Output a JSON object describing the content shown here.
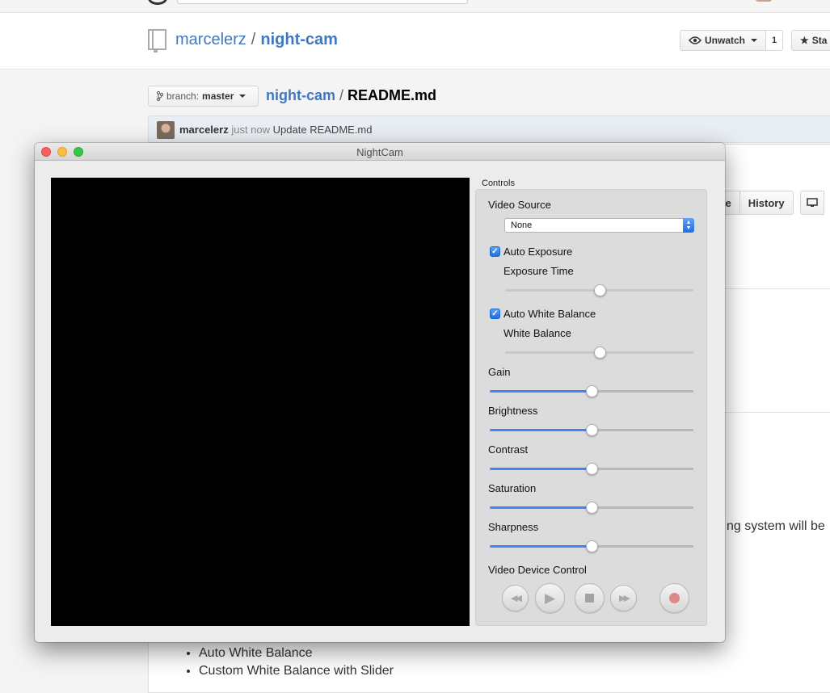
{
  "github": {
    "owner": "marcelerz",
    "separator": "/",
    "repo": "night-cam",
    "unwatch_label": "Unwatch",
    "watch_count": "1",
    "star_label": "Sta",
    "branch_label": "branch:",
    "branch_value": "master",
    "file_repo": "night-cam",
    "file_name": "README.md",
    "commit_author": "marcelerz",
    "commit_time": "just now",
    "commit_message": "Update README.md",
    "toolbar_blame_label": "me",
    "toolbar_history_label": "History",
    "readme_fragment": "ng system will be",
    "readme_items": [
      "Auto White Balance",
      "Custom White Balance with Slider"
    ]
  },
  "window": {
    "title": "NightCam",
    "controls_label": "Controls",
    "video_source": {
      "label": "Video Source",
      "value": "None"
    },
    "auto_exposure": {
      "label": "Auto Exposure",
      "checked": true,
      "checkmark": "✓"
    },
    "exposure_time": {
      "label": "Exposure Time",
      "value": 0.5
    },
    "auto_white_balance": {
      "label": "Auto White Balance",
      "checked": true,
      "checkmark": "✓"
    },
    "white_balance": {
      "label": "White Balance",
      "value": 0.5
    },
    "gain": {
      "label": "Gain",
      "value": 0.5
    },
    "brightness": {
      "label": "Brightness",
      "value": 0.5
    },
    "contrast": {
      "label": "Contrast",
      "value": 0.5
    },
    "saturation": {
      "label": "Saturation",
      "value": 0.5
    },
    "sharpness": {
      "label": "Sharpness",
      "value": 0.5
    },
    "device_control": {
      "label": "Video Device Control",
      "rewind_symbol": "◀◀",
      "play_symbol": "▶",
      "forward_symbol": "▶▶"
    }
  },
  "colors": {
    "link": "#4078c0",
    "accent": "#3b88f5",
    "video_bg": "#000000",
    "record": "#d98b8b"
  }
}
